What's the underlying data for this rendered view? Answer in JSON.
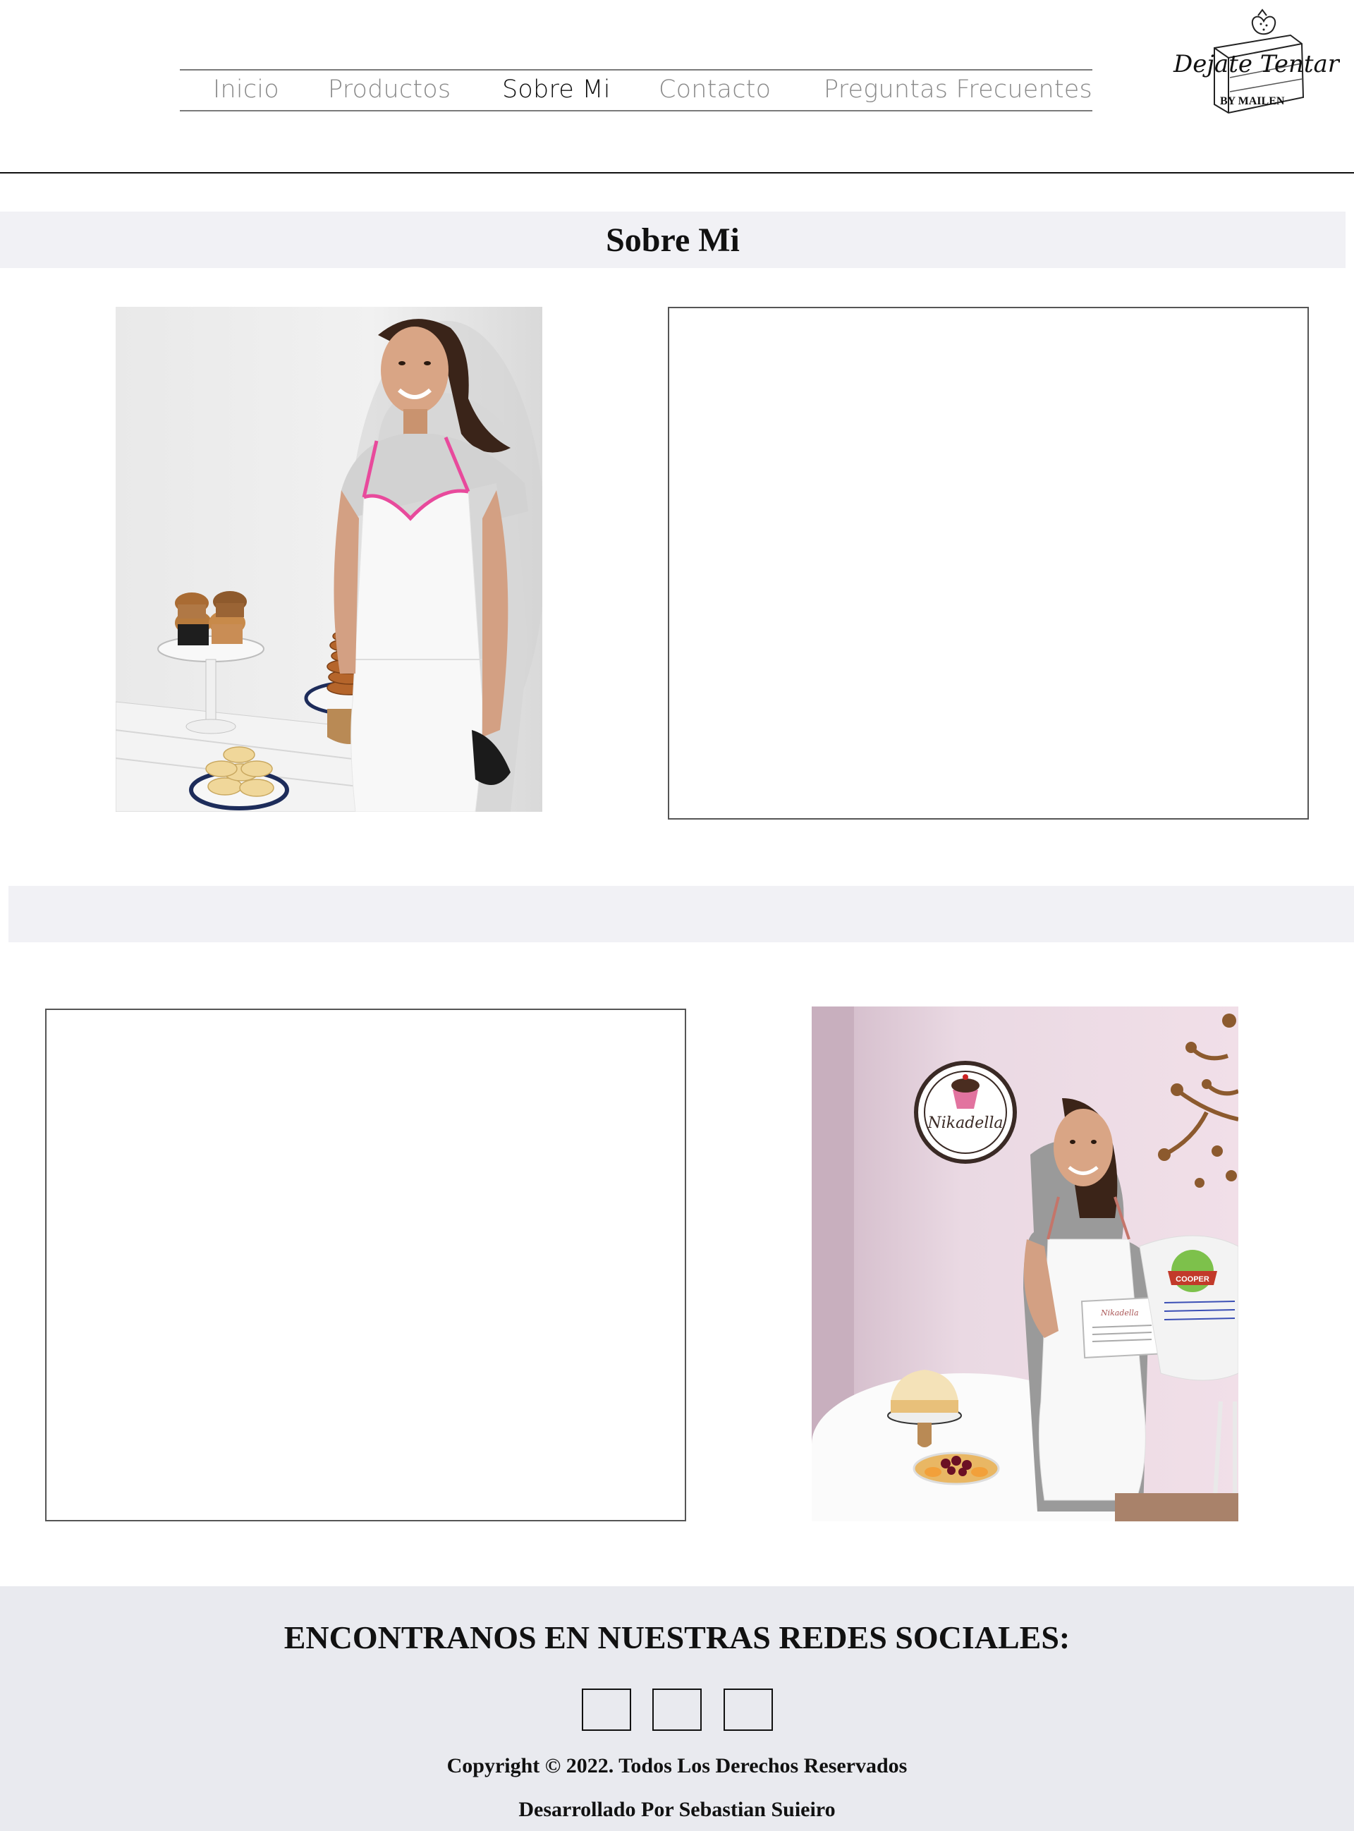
{
  "nav": {
    "items": [
      {
        "label": "Inicio"
      },
      {
        "label": "Productos"
      },
      {
        "label": "Sobre Mi"
      },
      {
        "label": "Contacto"
      },
      {
        "label": "Preguntas Frecuentes"
      }
    ],
    "active": "Sobre Mi"
  },
  "logo": {
    "script": "Dejate Tentar",
    "byline": "BY MAILEN"
  },
  "section": {
    "title": "Sobre Mi",
    "second_title": ""
  },
  "photos": {
    "photo1": {
      "icon": "photo-baker-with-pastries"
    },
    "photo2": {
      "icon": "photo-baker-with-certificate",
      "sign_text": "Nikadella",
      "bag_text": "COOPER"
    }
  },
  "footer": {
    "title": "ENCONTRANOS EN NUESTRAS REDES SOCIALES:",
    "social": [
      {
        "icon": "social-icon-1"
      },
      {
        "icon": "social-icon-2"
      },
      {
        "icon": "social-icon-3"
      }
    ],
    "copyright": "Copyright © 2022. Todos Los Derechos Reservados",
    "credit": "Desarrollado Por Sebastian Suieiro"
  },
  "colors": {
    "band": "#f1f1f5",
    "footer": "#e9eaef",
    "nav_inactive": "#8a8a8a",
    "nav_active": "#111111"
  }
}
